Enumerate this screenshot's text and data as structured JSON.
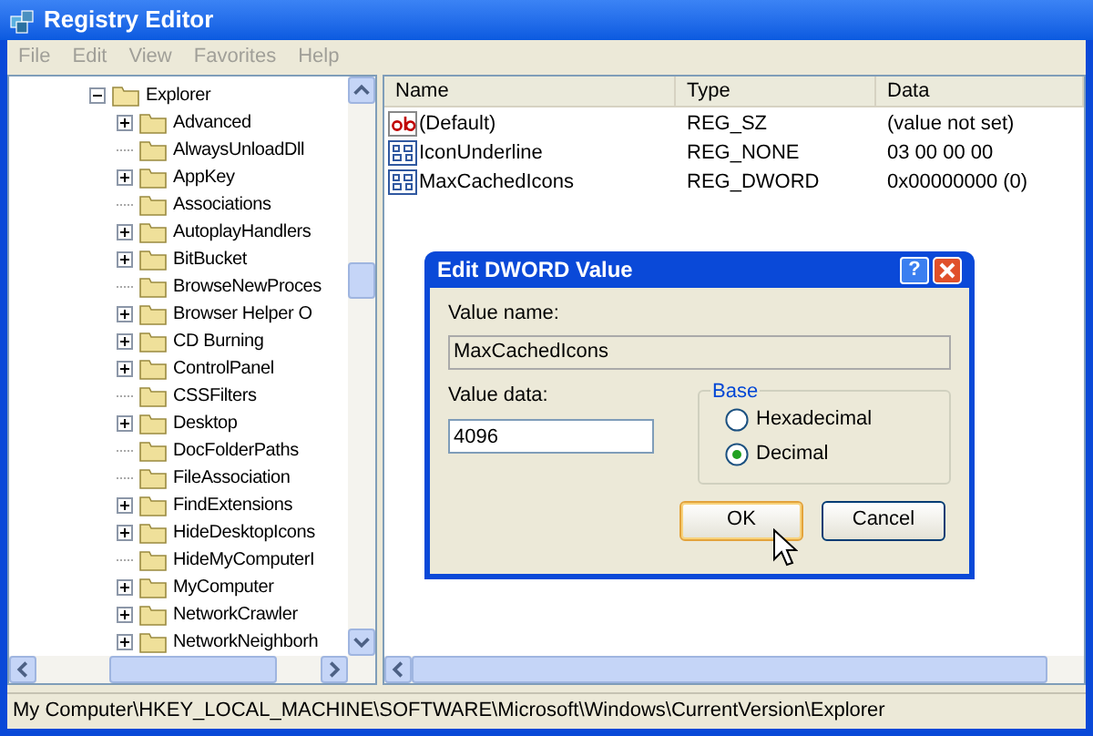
{
  "window": {
    "title": "Registry Editor"
  },
  "menu": [
    "File",
    "Edit",
    "View",
    "Favorites",
    "Help"
  ],
  "tree": {
    "label": "Explorer",
    "expanded": true,
    "children": [
      {
        "label": "Advanced",
        "expandable": true
      },
      {
        "label": "AlwaysUnloadDll",
        "expandable": false
      },
      {
        "label": "AppKey",
        "expandable": true
      },
      {
        "label": "Associations",
        "expandable": false
      },
      {
        "label": "AutoplayHandlers",
        "expandable": true
      },
      {
        "label": "BitBucket",
        "expandable": true
      },
      {
        "label": "BrowseNewProces",
        "expandable": false
      },
      {
        "label": "Browser Helper O",
        "expandable": true
      },
      {
        "label": "CD Burning",
        "expandable": true
      },
      {
        "label": "ControlPanel",
        "expandable": true
      },
      {
        "label": "CSSFilters",
        "expandable": false
      },
      {
        "label": "Desktop",
        "expandable": true
      },
      {
        "label": "DocFolderPaths",
        "expandable": false
      },
      {
        "label": "FileAssociation",
        "expandable": false
      },
      {
        "label": "FindExtensions",
        "expandable": true
      },
      {
        "label": "HideDesktopIcons",
        "expandable": true
      },
      {
        "label": "HideMyComputerI",
        "expandable": false
      },
      {
        "label": "MyComputer",
        "expandable": true
      },
      {
        "label": "NetworkCrawler",
        "expandable": true
      },
      {
        "label": "NetworkNeighborh",
        "expandable": true
      }
    ]
  },
  "values": {
    "columns": [
      "Name",
      "Type",
      "Data"
    ],
    "rows": [
      {
        "kind": "string",
        "name": "(Default)",
        "type": "REG_SZ",
        "data": "(value not set)"
      },
      {
        "kind": "binary",
        "name": "IconUnderline",
        "type": "REG_NONE",
        "data": "03 00 00 00"
      },
      {
        "kind": "binary",
        "name": "MaxCachedIcons",
        "type": "REG_DWORD",
        "data": "0x00000000 (0)"
      }
    ]
  },
  "dialog": {
    "title": "Edit DWORD Value",
    "help": "?",
    "value_name_label": "Value name:",
    "value_name": "MaxCachedIcons",
    "value_data_label": "Value data:",
    "value_data": "4096",
    "base_label": "Base",
    "base_options": [
      {
        "label": "Hexadecimal",
        "selected": false
      },
      {
        "label": "Decimal",
        "selected": true
      }
    ],
    "buttons": [
      {
        "label": "OK",
        "focused": true
      },
      {
        "label": "Cancel",
        "focused": false
      }
    ]
  },
  "status_bar": "My Computer\\HKEY_LOCAL_MACHINE\\SOFTWARE\\Microsoft\\Windows\\CurrentVersion\\Explorer"
}
